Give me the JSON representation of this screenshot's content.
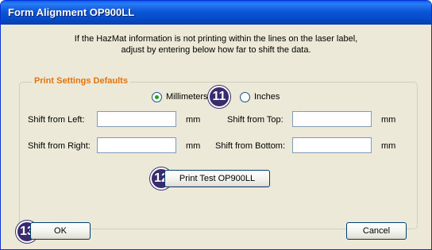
{
  "window": {
    "title": "Form Alignment OP900LL"
  },
  "intro": {
    "line1": "If the HazMat information is not printing within the lines on the laser label,",
    "line2": "adjust by entering below how far to shift the data."
  },
  "group": {
    "legend": "Print Settings Defaults",
    "units": {
      "millimeters_label": "Millimeters",
      "inches_label": "Inches",
      "selected": "Millimeters"
    },
    "fields": {
      "shift_left_label": "Shift from Left:",
      "shift_right_label": "Shift from Right:",
      "shift_top_label": "Shift from Top:",
      "shift_bottom_label": "Shift from Bottom:",
      "shift_left_value": "",
      "shift_right_value": "",
      "shift_top_value": "",
      "shift_bottom_value": "",
      "unit_label": "mm"
    },
    "print_test_label": "Print Test OP900LL"
  },
  "buttons": {
    "ok_label": "OK",
    "cancel_label": "Cancel"
  },
  "callouts": {
    "units_badge": "11",
    "print_test_badge": "12",
    "ok_badge": "13"
  },
  "colors": {
    "titlebar": "#0b57d8",
    "dialog_bg": "#ece9d8",
    "legend_text": "#e3730b",
    "callout_bg": "#3a2b6e"
  }
}
